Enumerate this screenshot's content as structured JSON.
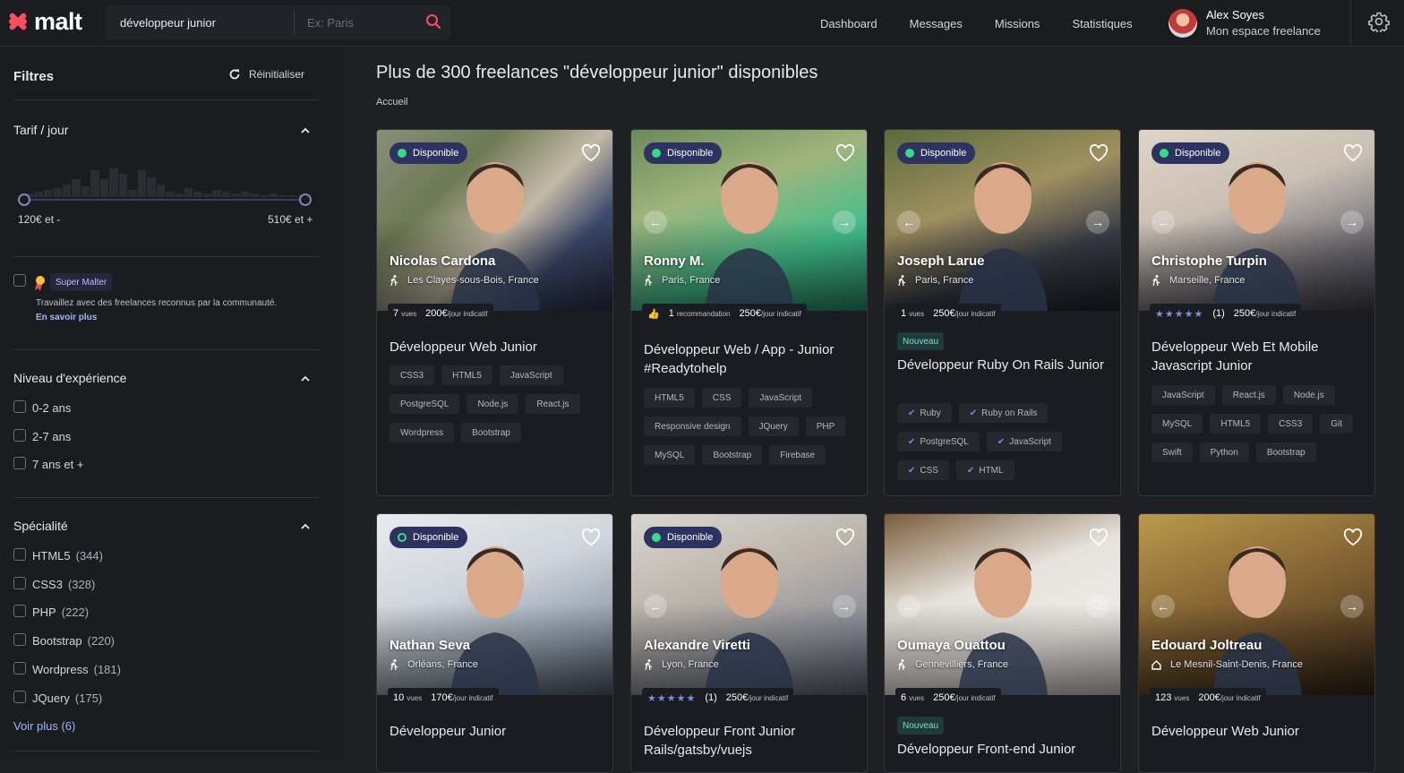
{
  "app": {
    "logo": "malt",
    "accent": "#ff4c61"
  },
  "search": {
    "query": "développeur junior",
    "location_placeholder": "Ex: Paris"
  },
  "nav": [
    "Dashboard",
    "Messages",
    "Missions",
    "Statistiques"
  ],
  "user": {
    "name": "Alex Soyes",
    "subtitle": "Mon espace freelance"
  },
  "filters": {
    "title": "Filtres",
    "reset": "Réinitialiser",
    "rate": {
      "title": "Tarif / jour",
      "min": "120€ et -",
      "max": "510€ et +"
    },
    "supermalter": {
      "badge": "Super Malter",
      "desc": "Travaillez avec des freelances reconnus par la communauté.",
      "link": "En savoir plus"
    },
    "experience": {
      "title": "Niveau d'expérience",
      "options": [
        "0-2 ans",
        "2-7 ans",
        "7 ans et +"
      ]
    },
    "specialty": {
      "title": "Spécialité",
      "options": [
        {
          "label": "HTML5",
          "count": "(344)"
        },
        {
          "label": "CSS3",
          "count": "(328)"
        },
        {
          "label": "PHP",
          "count": "(222)"
        },
        {
          "label": "Bootstrap",
          "count": "(220)"
        },
        {
          "label": "Wordpress",
          "count": "(181)"
        },
        {
          "label": "JQuery",
          "count": "(175)"
        }
      ],
      "more": "Voir plus (6)"
    }
  },
  "main": {
    "title": "Plus de 300 freelances \"développeur junior\" disponibles",
    "breadcrumb": "Accueil"
  },
  "freelancers": [
    {
      "name": "Nicolas Cardona",
      "location": "Les Clayes-sous-Bois, France",
      "status": "Disponible",
      "stat_value": "7",
      "stat_label": "vues",
      "rate": "200€",
      "rate_label": "/jour indicatif",
      "title": "Développeur Web Junior",
      "tags": [
        "CSS3",
        "HTML5",
        "JavaScript",
        "PostgreSQL",
        "Node.js",
        "React.js",
        "Wordpress",
        "Bootstrap"
      ]
    },
    {
      "name": "Ronny M.",
      "location": "Paris, France",
      "status": "Disponible",
      "stat_value": "1",
      "stat_label": "recommandation",
      "rate": "250€",
      "rate_label": "/jour indicatif",
      "title": "Développeur Web / App - Junior #Readytohelp",
      "tags": [
        "HTML5",
        "CSS",
        "JavaScript",
        "Responsive design",
        "JQuery",
        "PHP",
        "MySQL",
        "Bootstrap",
        "Firebase"
      ]
    },
    {
      "name": "Joseph Larue",
      "location": "Paris, France",
      "status": "Disponible",
      "stat_value": "1",
      "stat_label": "vues",
      "rate": "250€",
      "rate_label": "/jour indicatif",
      "badge": "Nouveau",
      "title": "Développeur Ruby On Rails Junior",
      "tags": [
        "Ruby",
        "Ruby on Rails",
        "PostgreSQL",
        "JavaScript",
        "CSS",
        "HTML"
      ]
    },
    {
      "name": "Christophe Turpin",
      "location": "Marseille, France",
      "status": "Disponible",
      "stars": "★★★★★",
      "reviews": "(1)",
      "rate": "250€",
      "rate_label": "/jour indicatif",
      "title": "Développeur Web Et Mobile Javascript Junior",
      "tags": [
        "JavaScript",
        "React.js",
        "Node.js",
        "MySQL",
        "HTML5",
        "CSS3",
        "Git",
        "Swift",
        "Python",
        "Bootstrap"
      ]
    },
    {
      "name": "Nathan Seva",
      "location": "Orléans, France",
      "status": "Disponible",
      "stat_value": "10",
      "stat_label": "vues",
      "rate": "170€",
      "rate_label": "/jour indicatif",
      "title": "Développeur Junior"
    },
    {
      "name": "Alexandre Viretti",
      "location": "Lyon, France",
      "status": "Disponible",
      "stars": "★★★★★",
      "reviews": "(1)",
      "rate": "250€",
      "rate_label": "/jour indicatif",
      "title": "Développeur Front Junior Rails/gatsby/vuejs"
    },
    {
      "name": "Oumaya Ouattou",
      "location": "Gennevilliers, France",
      "stat_value": "6",
      "stat_label": "vues",
      "rate": "250€",
      "rate_label": "/jour indicatif",
      "badge": "Nouveau",
      "title": "Développeur Front-end Junior"
    },
    {
      "name": "Edouard Joltreau",
      "location": "Le Mesnil-Saint-Denis, France",
      "stat_value": "123",
      "stat_label": "vues",
      "rate": "200€",
      "rate_label": "/jour indicatif",
      "title": "Développeur Web Junior"
    }
  ]
}
